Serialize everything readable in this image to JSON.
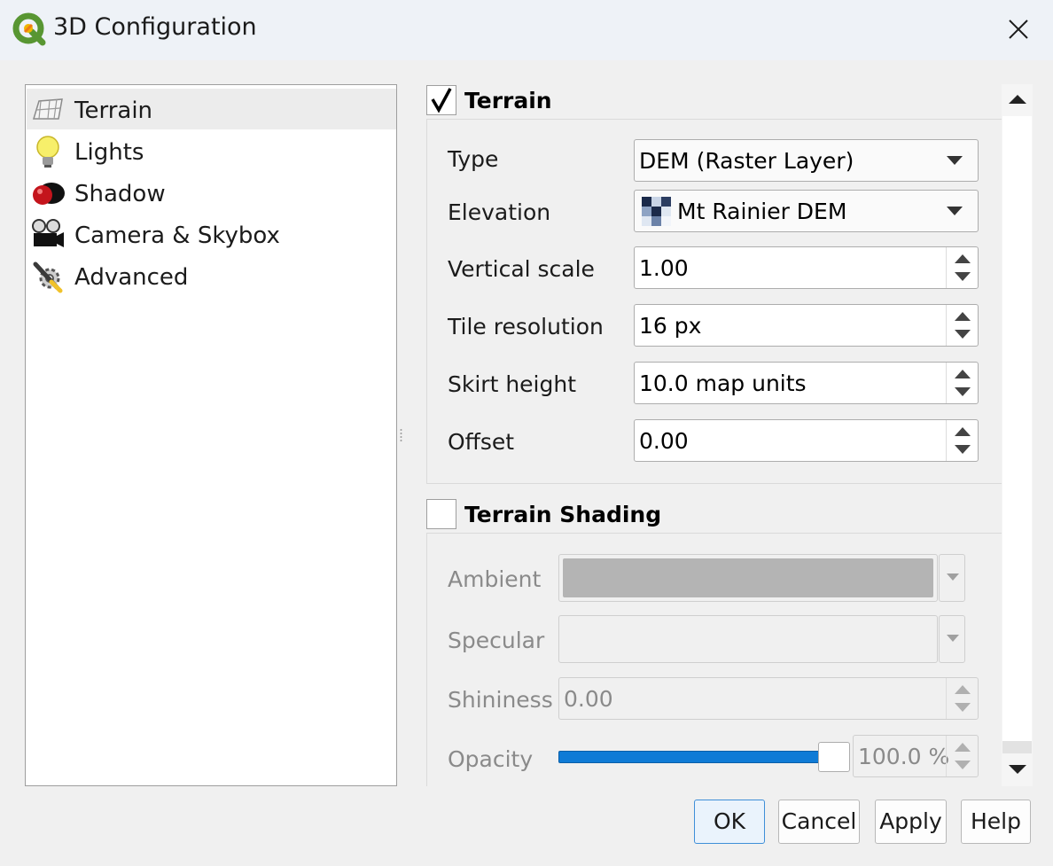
{
  "window": {
    "title": "3D Configuration"
  },
  "sidebar": {
    "items": [
      {
        "label": "Terrain",
        "icon": "terrain-icon",
        "selected": true
      },
      {
        "label": "Lights",
        "icon": "lightbulb-icon",
        "selected": false
      },
      {
        "label": "Shadow",
        "icon": "shadow-icon",
        "selected": false
      },
      {
        "label": "Camera & Skybox",
        "icon": "camera-icon",
        "selected": false
      },
      {
        "label": "Advanced",
        "icon": "wrench-gear-icon",
        "selected": false
      }
    ]
  },
  "terrain": {
    "title": "Terrain",
    "checked": true,
    "type": {
      "label": "Type",
      "value": "DEM (Raster Layer)"
    },
    "elevation": {
      "label": "Elevation",
      "value": "Mt Rainier DEM"
    },
    "vertical_scale": {
      "label": "Vertical scale",
      "value": "1.00"
    },
    "tile_resolution": {
      "label": "Tile resolution",
      "value": "16 px"
    },
    "skirt_height": {
      "label": "Skirt height",
      "value": "10.0 map units"
    },
    "offset": {
      "label": "Offset",
      "value": "0.00"
    }
  },
  "terrain_shading": {
    "title": "Terrain Shading",
    "checked": false,
    "ambient": {
      "label": "Ambient",
      "color": "#b4b4b4"
    },
    "specular": {
      "label": "Specular",
      "color": "#f0f0f0"
    },
    "shininess": {
      "label": "Shininess",
      "value": "0.00"
    },
    "opacity": {
      "label": "Opacity",
      "value": "100.0 %",
      "level": 1.0
    }
  },
  "buttons": {
    "ok": "OK",
    "cancel": "Cancel",
    "apply": "Apply",
    "help": "Help"
  },
  "colors": {
    "accent": "#0f7bd6",
    "qgis_green": "#589632",
    "qgis_yellow": "#f0b400"
  }
}
